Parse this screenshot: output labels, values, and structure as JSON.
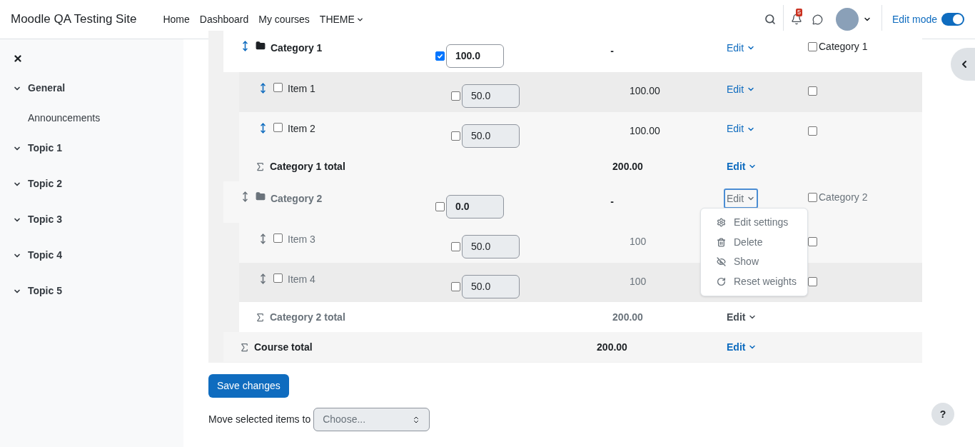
{
  "header": {
    "site_name": "Moodle QA Testing Site",
    "nav": [
      {
        "label": "Home",
        "dropdown": false
      },
      {
        "label": "Dashboard",
        "dropdown": false
      },
      {
        "label": "My courses",
        "dropdown": false
      },
      {
        "label": "THEME",
        "dropdown": true
      }
    ],
    "notification_count": "5",
    "edit_mode": {
      "label": "Edit mode",
      "on": true
    }
  },
  "sidebar": {
    "sections": [
      {
        "title": "General",
        "expanded": true,
        "children": [
          {
            "label": "Announcements"
          }
        ]
      },
      {
        "title": "Topic 1",
        "expanded": true
      },
      {
        "title": "Topic 2",
        "expanded": true
      },
      {
        "title": "Topic 3",
        "expanded": true
      },
      {
        "title": "Topic 4",
        "expanded": true
      },
      {
        "title": "Topic 5",
        "expanded": true
      }
    ]
  },
  "gradebook": {
    "categories": [
      {
        "name": "Category 1",
        "hidden": false,
        "override": true,
        "weight": "100.0",
        "weight_disabled": false,
        "max": "-",
        "edit": "Edit",
        "menu_open": false,
        "move_label": "Category 1",
        "move_checked": false,
        "items": [
          {
            "name": "Item 1",
            "checked": false,
            "override": false,
            "weight": "50.0",
            "max": "100.00",
            "edit": "Edit",
            "move_checked": false
          },
          {
            "name": "Item 2",
            "checked": false,
            "override": false,
            "weight": "50.0",
            "max": "100.00",
            "edit": "Edit",
            "move_checked": false
          }
        ],
        "total": {
          "name": "Category 1 total",
          "max": "200.00",
          "edit": "Edit"
        }
      },
      {
        "name": "Category 2",
        "hidden": true,
        "override": false,
        "weight": "0.0",
        "weight_disabled": true,
        "max": "-",
        "edit": "Edit",
        "menu_open": true,
        "move_label": "Category 2",
        "move_checked": false,
        "items": [
          {
            "name": "Item 3",
            "checked": false,
            "override": false,
            "weight": "50.0",
            "max": "100",
            "move_checked": false
          },
          {
            "name": "Item 4",
            "checked": false,
            "override": false,
            "weight": "50.0",
            "max": "100",
            "move_checked": false
          }
        ],
        "total": {
          "name": "Category 2 total",
          "max": "200.00",
          "edit": "Edit"
        }
      }
    ],
    "menu": [
      {
        "label": "Edit settings"
      },
      {
        "label": "Delete"
      },
      {
        "label": "Show"
      },
      {
        "label": "Reset weights"
      }
    ],
    "course_total": {
      "name": "Course total",
      "max": "200.00",
      "edit": "Edit"
    }
  },
  "footer": {
    "save": "Save changes",
    "move_label": "Move selected items to",
    "move_placeholder": "Choose...",
    "help": "?"
  }
}
